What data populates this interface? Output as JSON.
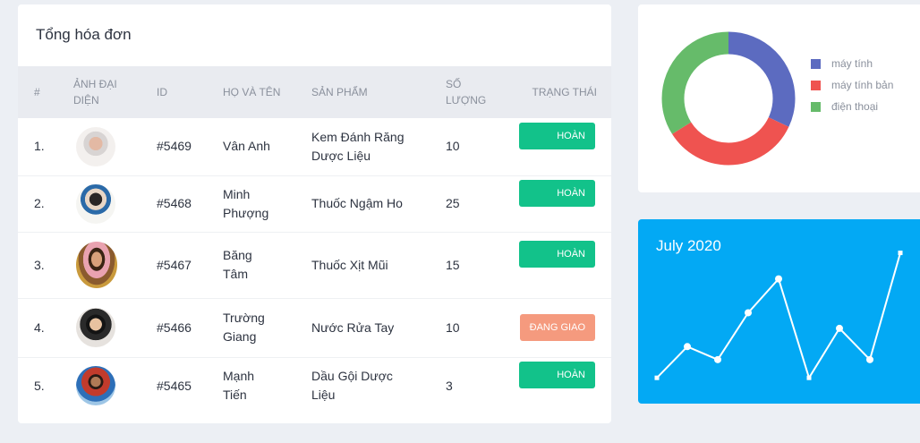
{
  "orders": {
    "title": "Tổng hóa đơn",
    "headers": {
      "num": "#",
      "avatar_line1": "ẢNH ĐẠI",
      "avatar_line2": "DIỆN",
      "id": "ID",
      "name": "HỌ VÀ TÊN",
      "product": "SẢN PHẨM",
      "qty_line1": "SỐ",
      "qty_line2": "LƯỢNG",
      "status": "TRẠNG THÁI"
    },
    "rows": [
      {
        "num": "1.",
        "id": "#5469",
        "name_line1": "Vân Anh",
        "name_line2": "",
        "product_line1": "Kem Đánh Răng",
        "product_line2": "Dược Liệu",
        "qty": "10",
        "status": "HOÀN THÀNH"
      },
      {
        "num": "2.",
        "id": "#5468",
        "name_line1": "Minh",
        "name_line2": "Phượng",
        "product_line1": "Thuốc Ngậm Ho",
        "product_line2": "",
        "qty": "25",
        "status": "HOÀN THÀNH"
      },
      {
        "num": "3.",
        "id": "#5467",
        "name_line1": "Băng",
        "name_line2": "Tâm",
        "product_line1": "Thuốc Xịt Mũi",
        "product_line2": "",
        "qty": "15",
        "status": "HOÀN THÀNH"
      },
      {
        "num": "4.",
        "id": "#5466",
        "name_line1": "Trường",
        "name_line2": "Giang",
        "product_line1": "Nước Rửa Tay",
        "product_line2": "",
        "qty": "10",
        "status": "ĐANG GIAO"
      },
      {
        "num": "5.",
        "id": "#5465",
        "name_line1": "Mạnh",
        "name_line2": "Tiến",
        "product_line1": "Dầu Gội Dược",
        "product_line2": "Liệu",
        "qty": "3",
        "status": "HOÀN THÀNH"
      }
    ]
  },
  "colors": {
    "done": "#12c28a",
    "shipping": "#f59a7e",
    "accent_blue": "#03a9f4"
  },
  "pie": {
    "legend": [
      {
        "label": "máy tính",
        "color": "#5c6bc0"
      },
      {
        "label": "máy tính bản",
        "color": "#ef5350"
      },
      {
        "label": "điện thoại",
        "color": "#66bb6a"
      }
    ],
    "chart_data": {
      "type": "pie",
      "labels": [
        "máy tính",
        "máy tính bản",
        "điện thoại"
      ],
      "values": [
        32,
        34,
        34
      ]
    }
  },
  "line": {
    "title": "July 2020",
    "chart_data": {
      "type": "line",
      "x": [
        1,
        2,
        3,
        4,
        5,
        6,
        7,
        8,
        9
      ],
      "values": [
        2,
        14,
        9,
        27,
        40,
        2,
        21,
        9,
        50
      ],
      "ylim": [
        0,
        55
      ]
    }
  }
}
